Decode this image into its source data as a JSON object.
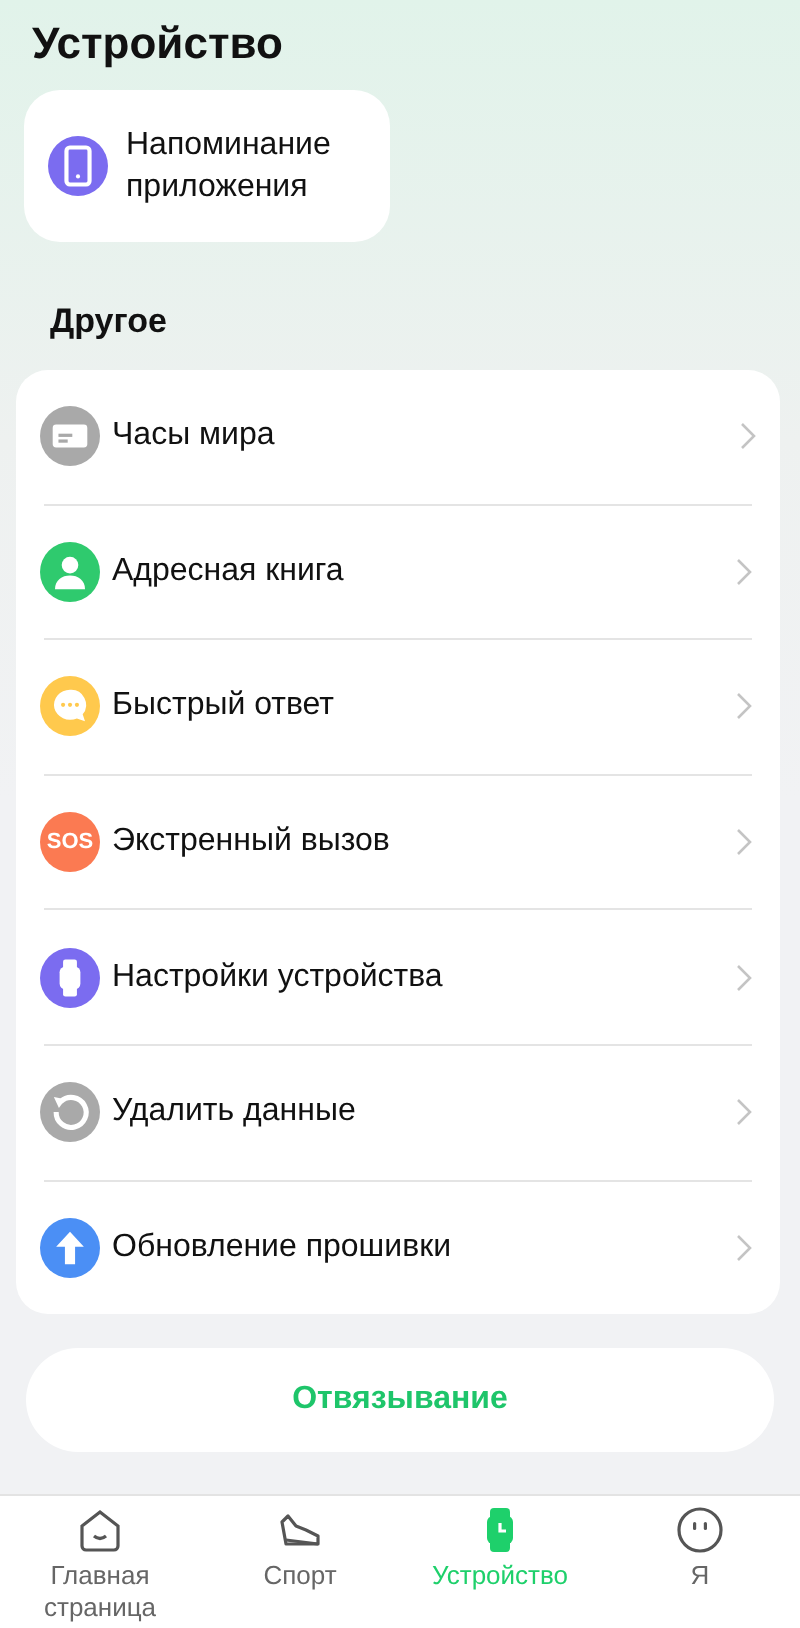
{
  "header": {
    "title": "Устройство"
  },
  "shortcut": {
    "kind": "phone",
    "label": "Напоминание приложения"
  },
  "section": {
    "title": "Другое"
  },
  "items": [
    {
      "kind": "card",
      "label": "Часы мира"
    },
    {
      "kind": "person",
      "label": "Адресная книга"
    },
    {
      "kind": "chat",
      "label": "Быстрый ответ"
    },
    {
      "kind": "sos",
      "label": "Экстренный вызов",
      "icon_text": "SOS"
    },
    {
      "kind": "watch",
      "label": "Настройки устройства"
    },
    {
      "kind": "reset",
      "label": "Удалить данные"
    },
    {
      "kind": "upload",
      "label": "Обновление прошивки"
    }
  ],
  "unbind_button": {
    "label": "Отвязывание"
  },
  "tabs": [
    {
      "kind": "home",
      "label": "Главная страница",
      "selected": false
    },
    {
      "kind": "shoe",
      "label": "Спорт",
      "selected": false
    },
    {
      "kind": "watch",
      "label": "Устройство",
      "selected": true
    },
    {
      "kind": "face",
      "label": "Я",
      "selected": false
    }
  ]
}
